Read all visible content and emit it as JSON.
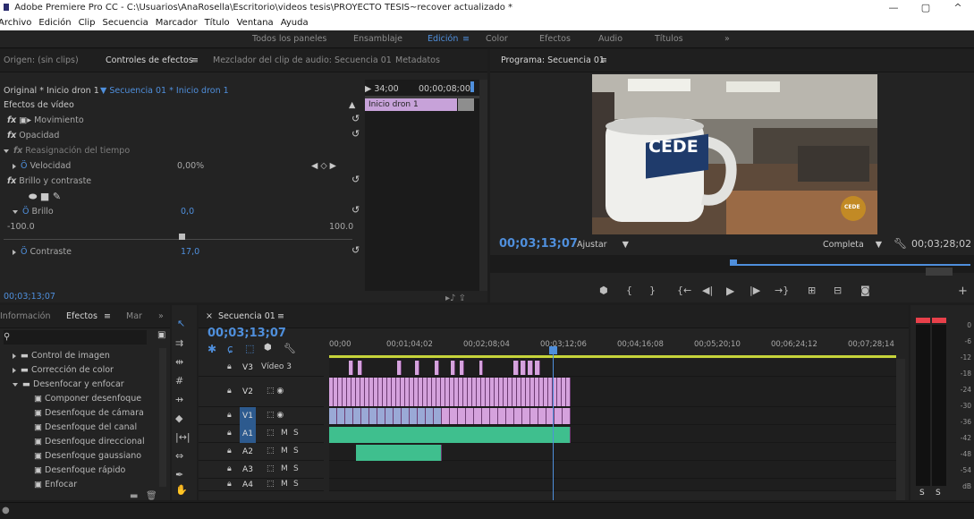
{
  "window": {
    "title": "Adobe Premiere Pro CC - C:\\Usuarios\\AnaRosella\\Escritorio\\videos tesis\\PROYECTO TESIS~recover actualizado *",
    "controls": [
      "—",
      "▢",
      "^"
    ]
  },
  "menu": [
    "Archivo",
    "Edición",
    "Clip",
    "Secuencia",
    "Marcador",
    "Título",
    "Ventana",
    "Ayuda"
  ],
  "workspaces": {
    "items": [
      "Todos los paneles",
      "Ensamblaje",
      "Edición",
      "Color",
      "Efectos",
      "Audio",
      "Títulos"
    ],
    "active": "Edición",
    "more": "»"
  },
  "effect_controls": {
    "tabs": [
      "Origen: (sin clips)",
      "Controles de efectos",
      "Mezclador del clip de audio: Secuencia 01",
      "Metadatos"
    ],
    "active_tab": "Controles de efectos",
    "header_left": "Original * Inicio dron 1",
    "header_seq": "Secuencia 01 * Inicio dron 1",
    "ruler_left": "34;00",
    "ruler_right": "00;00;08;00",
    "section": "Efectos de vídeo",
    "clip_name": "Inicio dron 1",
    "effects": {
      "movimiento": "Movimiento",
      "opacidad": "Opacidad",
      "reasignacion": "Reasignación del tiempo",
      "velocidad": "Velocidad",
      "velocidad_value": "0,00%",
      "brillo_contraste": "Brillo y contraste",
      "brillo": "Brillo",
      "brillo_value": "0,0",
      "brillo_min": "-100.0",
      "brillo_max": "100.0",
      "contraste": "Contraste",
      "contraste_value": "17,0"
    },
    "footer_time": "00;03;13;07"
  },
  "program": {
    "title": "Programa: Secuencia 01",
    "menu_icon": "≡",
    "timecode": "00;03;13;07",
    "fit_label": "Ajustar",
    "quality_label": "Completa",
    "duration": "00;03;28;02",
    "mug_text": "CEDE",
    "logo_text": "CEDE",
    "progress": 0.21
  },
  "effects_panel": {
    "tabs": [
      "Información",
      "Efectos",
      "Mar"
    ],
    "active_tab": "Efectos",
    "items": [
      {
        "label": "Control de imagen",
        "type": "folder",
        "open": false
      },
      {
        "label": "Corrección de color",
        "type": "folder",
        "open": false
      },
      {
        "label": "Desenfocar y enfocar",
        "type": "folder",
        "open": true
      },
      {
        "label": "Componer desenfoque",
        "type": "effect"
      },
      {
        "label": "Desenfoque de cámara",
        "type": "effect"
      },
      {
        "label": "Desenfoque del canal",
        "type": "effect"
      },
      {
        "label": "Desenfoque direccional",
        "type": "effect"
      },
      {
        "label": "Desenfoque gaussiano",
        "type": "effect"
      },
      {
        "label": "Desenfoque rápido",
        "type": "effect"
      },
      {
        "label": "Enfocar",
        "type": "effect"
      }
    ]
  },
  "timeline": {
    "tab": "Secuencia 01",
    "timecode": "00;03;13;07",
    "ruler": [
      "00;00",
      "00;01;04;02",
      "00;02;08;04",
      "00;03;12;06",
      "00;04;16;08",
      "00;05;20;10",
      "00;06;24;12",
      "00;07;28;14"
    ],
    "tracks": [
      {
        "id": "V3",
        "name": "Vídeo 3"
      },
      {
        "id": "V2",
        "name": ""
      },
      {
        "id": "V1",
        "name": ""
      },
      {
        "id": "A1",
        "name": ""
      },
      {
        "id": "A2",
        "name": ""
      },
      {
        "id": "A3",
        "name": ""
      },
      {
        "id": "A4",
        "name": ""
      }
    ],
    "mute": "M",
    "solo": "S",
    "playhead_fraction": 0.395
  },
  "meters": {
    "labels": [
      "0",
      "-6",
      "-12",
      "-18",
      "-24",
      "-30",
      "-36",
      "-42",
      "-48",
      "-54",
      "dB"
    ],
    "solo_buttons": [
      "S",
      "S"
    ]
  },
  "colors": {
    "accent": "#4f8fdc",
    "video_clip": "#d5a2dd",
    "audio_clip": "#3fbf8e",
    "playhead": "#4f8fdc",
    "meter_red": "#e8404a"
  }
}
